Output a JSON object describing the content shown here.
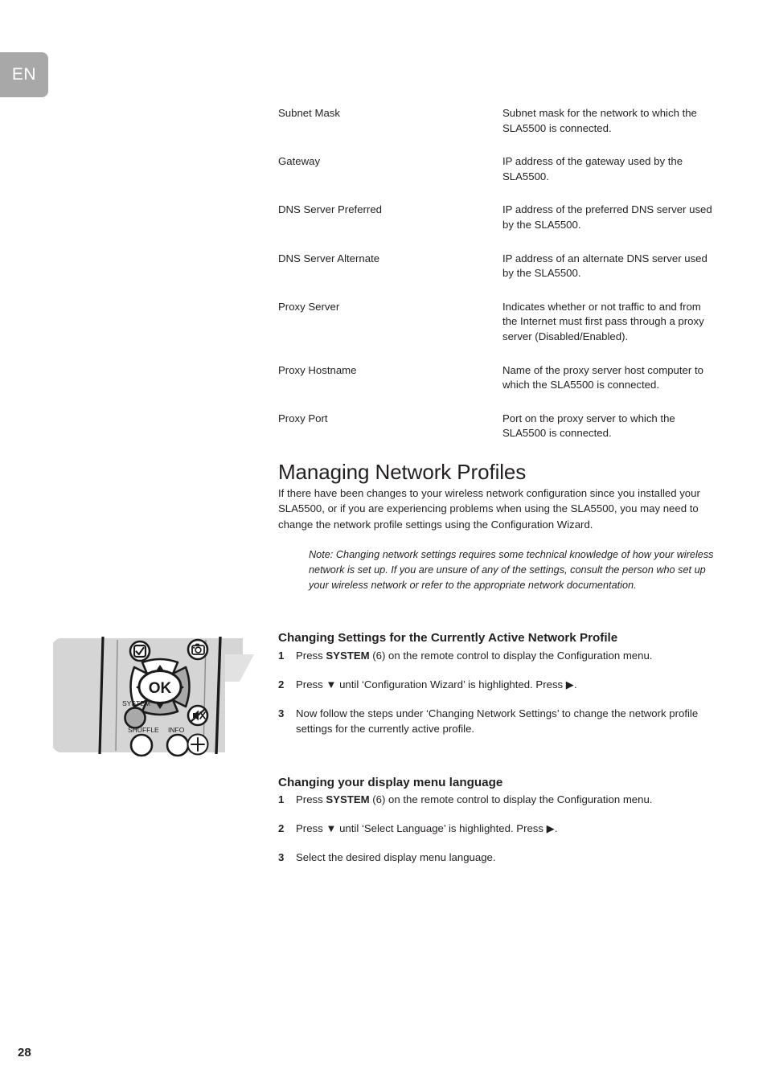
{
  "language_tab": {
    "label": "EN"
  },
  "page_number": "28",
  "settings_table": {
    "rows": [
      {
        "term": "Subnet Mask",
        "description": "Subnet mask for the network to which the SLA5500 is connected."
      },
      {
        "term": "Gateway",
        "description": "IP address of the gateway used by the SLA5500."
      },
      {
        "term": "DNS Server Preferred",
        "description": "IP address of the preferred DNS server used by the SLA5500."
      },
      {
        "term": "DNS Server Alternate",
        "description": "IP address of an alternate DNS server used by the SLA5500."
      },
      {
        "term": "Proxy Server",
        "description": "Indicates whether or not traffic to and from the Internet must first pass through a proxy server (Disabled/Enabled)."
      },
      {
        "term": "Proxy Hostname",
        "description": "Name of the proxy server host computer to which the SLA5500 is connected."
      },
      {
        "term": "Proxy Port",
        "description": "Port on the proxy server to which the SLA5500 is connected."
      }
    ]
  },
  "managing_profiles": {
    "heading": "Managing Network Profiles",
    "paragraph": "If there have been changes to your wireless network configuration since you installed your SLA5500, or if you are experiencing problems when using the SLA5500, you may need to change the network profile settings using the Configuration Wizard.",
    "note": "Note: Changing network settings requires some technical knowledge of how your wireless network is set up. If you are unsure of any of the settings, consult the person who set up your wireless network or refer to the appropriate network documentation."
  },
  "active_profile_section": {
    "heading": "Changing Settings for the Currently Active Network Profile",
    "steps": [
      {
        "number": "1",
        "before": "Press ",
        "bold": "SYSTEM",
        "after": " (6) on the remote control to display the Configuration menu."
      },
      {
        "number": "2",
        "before": "Press ▼ until ‘Configuration Wizard’ is highlighted. Press ▶.",
        "bold": "",
        "after": ""
      },
      {
        "number": "3",
        "before": "Now follow the steps under ‘Changing Network Settings’ to change the network profile settings for the currently active profile.",
        "bold": "",
        "after": ""
      }
    ]
  },
  "language_section": {
    "heading": "Changing your display menu language",
    "steps": [
      {
        "number": "1",
        "before": "Press ",
        "bold": "SYSTEM",
        "after": " (6) on the remote control to display the Configuration menu."
      },
      {
        "number": "2",
        "before": "Press ▼ until ‘Select Language’ is highlighted. Press ▶.",
        "bold": "",
        "after": ""
      },
      {
        "number": "3",
        "before": "Select the desired display menu language.",
        "bold": "",
        "after": ""
      }
    ]
  },
  "remote_control": {
    "buttons": {
      "system_label": "SYSTEM",
      "shuffle_label": "SHUFFLE",
      "info_label": "INFO",
      "ok_label": "OK"
    },
    "colors": {
      "body": "#d5d5d5",
      "highlight": "#a9a9a9",
      "outline": "#1a1a1a",
      "flap": "#e2e2e2"
    }
  }
}
